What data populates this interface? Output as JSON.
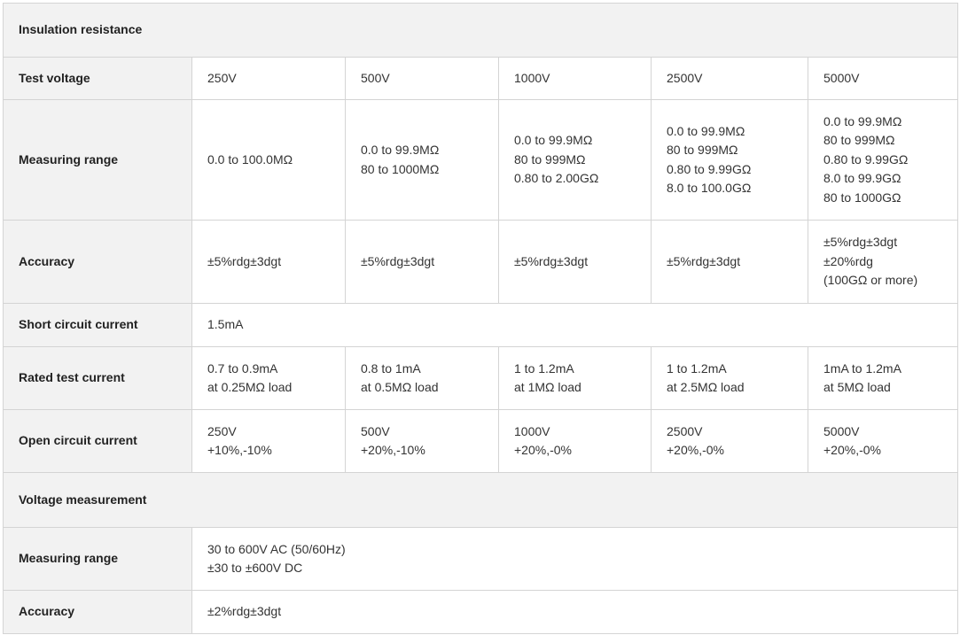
{
  "insulation": {
    "section_title": "Insulation resistance",
    "test_voltage": {
      "label": "Test voltage",
      "values": [
        "250V",
        "500V",
        "1000V",
        "2500V",
        "5000V"
      ]
    },
    "measuring_range": {
      "label": "Measuring range",
      "values": [
        [
          "0.0 to 100.0MΩ"
        ],
        [
          "0.0 to 99.9MΩ",
          "80 to 1000MΩ"
        ],
        [
          "0.0 to 99.9MΩ",
          "80 to 999MΩ",
          "0.80 to 2.00GΩ"
        ],
        [
          "0.0 to 99.9MΩ",
          "80 to 999MΩ",
          "0.80 to 9.99GΩ",
          "8.0 to 100.0GΩ"
        ],
        [
          "0.0 to 99.9MΩ",
          "80 to 999MΩ",
          "0.80 to 9.99GΩ",
          "8.0 to 99.9GΩ",
          "80 to 1000GΩ"
        ]
      ]
    },
    "accuracy": {
      "label": "Accuracy",
      "values": [
        [
          "±5%rdg±3dgt"
        ],
        [
          "±5%rdg±3dgt"
        ],
        [
          "±5%rdg±3dgt"
        ],
        [
          "±5%rdg±3dgt"
        ],
        [
          "±5%rdg±3dgt",
          "±20%rdg",
          "(100GΩ or more)"
        ]
      ]
    },
    "short_circuit_current": {
      "label": "Short circuit current",
      "value": "1.5mA"
    },
    "rated_test_current": {
      "label": "Rated test current",
      "values": [
        [
          "0.7 to 0.9mA",
          "at 0.25MΩ load"
        ],
        [
          "0.8 to 1mA",
          "at 0.5MΩ load"
        ],
        [
          "1 to 1.2mA",
          "at 1MΩ load"
        ],
        [
          "1 to 1.2mA",
          "at 2.5MΩ load"
        ],
        [
          "1mA to 1.2mA",
          "at 5MΩ load"
        ]
      ]
    },
    "open_circuit_current": {
      "label": "Open circuit current",
      "values": [
        [
          "250V",
          "+10%,-10%"
        ],
        [
          "500V",
          "+20%,-10%"
        ],
        [
          "1000V",
          "+20%,-0%"
        ],
        [
          "2500V",
          "+20%,-0%"
        ],
        [
          "5000V",
          "+20%,-0%"
        ]
      ]
    }
  },
  "voltage": {
    "section_title": "Voltage measurement",
    "measuring_range": {
      "label": "Measuring range",
      "values": [
        "30 to 600V AC (50/60Hz)",
        "±30 to ±600V DC"
      ]
    },
    "accuracy": {
      "label": "Accuracy",
      "value": "±2%rdg±3dgt"
    }
  },
  "colors": {
    "label_background": "#f2f2f2",
    "border": "#d4d4d4",
    "text": "#333333"
  }
}
